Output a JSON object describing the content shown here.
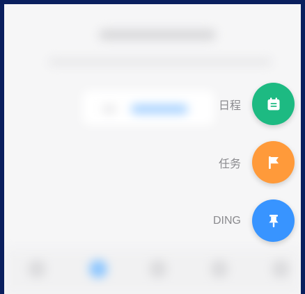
{
  "menu": {
    "items": [
      {
        "label": "日程",
        "icon": "calendar-icon",
        "color": "#1dba82"
      },
      {
        "label": "任务",
        "icon": "flag-icon",
        "color": "#ff9a3a"
      },
      {
        "label": "DING",
        "icon": "pin-icon",
        "color": "#3894ff"
      }
    ]
  },
  "colors": {
    "frame_border": "#0a1f5e",
    "background": "#f6f6f7"
  }
}
